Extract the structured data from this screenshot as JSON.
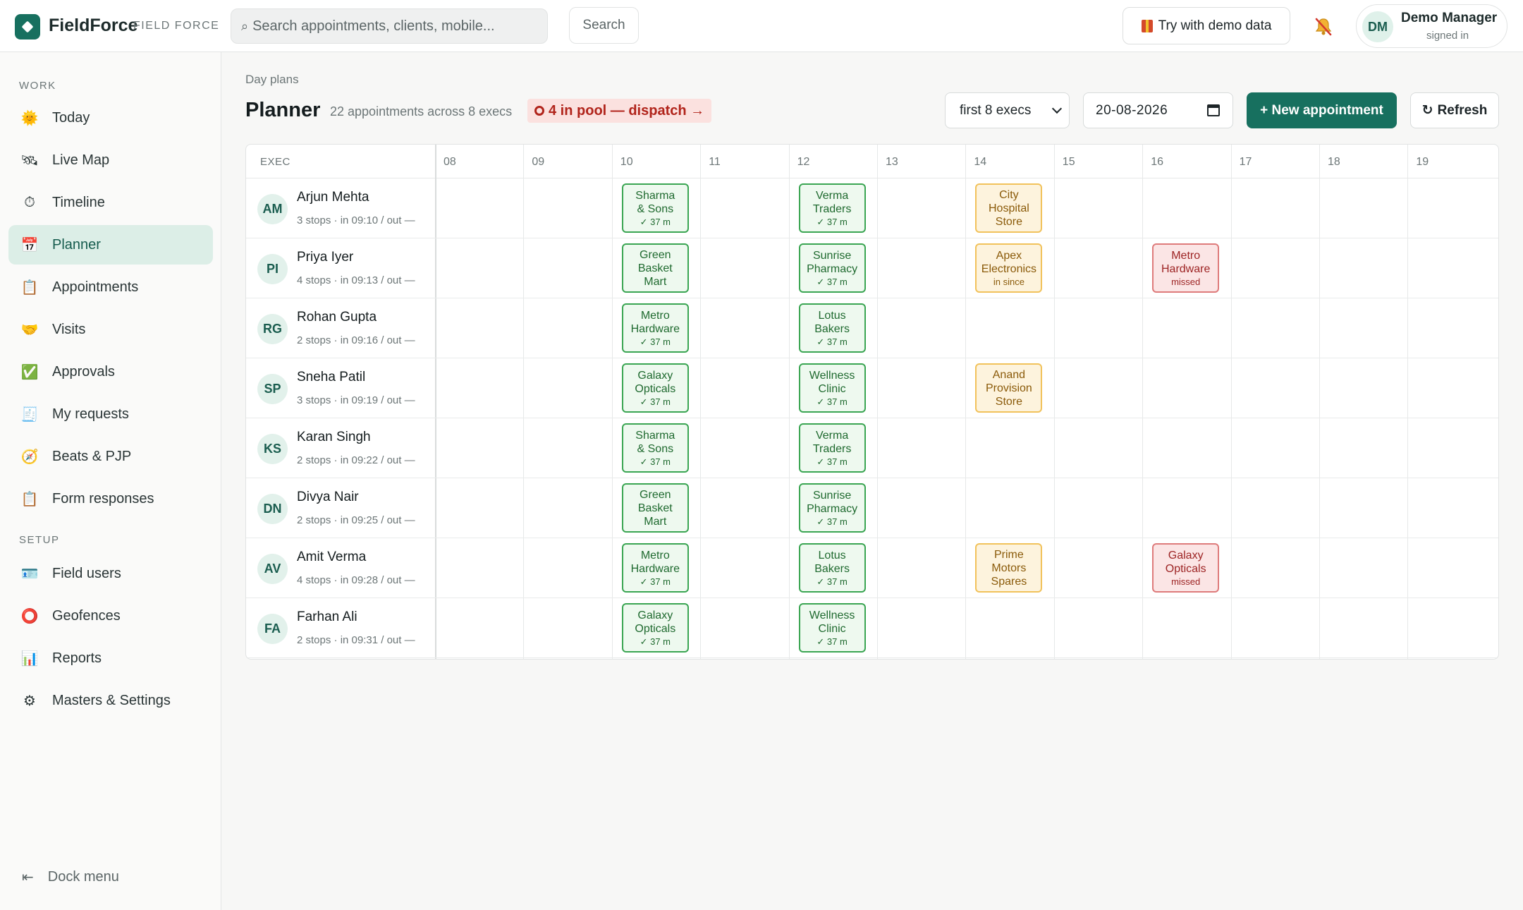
{
  "app": {
    "brand": "FieldForce",
    "brand_sub": "FIELD FORCE"
  },
  "search": {
    "placeholder": "Search appointments, clients, mobile...",
    "button": "Search"
  },
  "topbar": {
    "demo_button": "Try with demo data"
  },
  "user": {
    "initials": "DM",
    "name": "Demo Manager",
    "status": "signed in"
  },
  "sidebar": {
    "work_label": "WORK",
    "setup_label": "SETUP",
    "work_items": [
      {
        "label": "Today",
        "icon": "sun-icon",
        "glyph": "🌞"
      },
      {
        "label": "Live Map",
        "icon": "satellite-icon",
        "glyph": "🛰"
      },
      {
        "label": "Timeline",
        "icon": "stopwatch-icon",
        "glyph": "⏱"
      },
      {
        "label": "Planner",
        "icon": "calendar-icon",
        "glyph": "📅"
      },
      {
        "label": "Appointments",
        "icon": "clipboard-icon",
        "glyph": "📋"
      },
      {
        "label": "Visits",
        "icon": "handshake-icon",
        "glyph": "🤝"
      },
      {
        "label": "Approvals",
        "icon": "check-icon",
        "glyph": "✅"
      },
      {
        "label": "My requests",
        "icon": "receipt-icon",
        "glyph": "🧾"
      },
      {
        "label": "Beats & PJP",
        "icon": "compass-icon",
        "glyph": "🧭"
      },
      {
        "label": "Form responses",
        "icon": "clipboard-icon",
        "glyph": "📋"
      }
    ],
    "setup_items": [
      {
        "label": "Field users",
        "icon": "id-card-icon",
        "glyph": "🪪"
      },
      {
        "label": "Geofences",
        "icon": "ring-icon",
        "glyph": "⭕"
      },
      {
        "label": "Reports",
        "icon": "bar-chart-icon",
        "glyph": "📊"
      },
      {
        "label": "Masters & Settings",
        "icon": "gear-icon",
        "glyph": "⚙"
      }
    ],
    "active": "Planner",
    "dock_label": "Dock menu"
  },
  "page": {
    "breadcrumb": "Day plans",
    "title": "Planner",
    "subtitle": "22 appointments across 8 execs",
    "pool_badge": "4 in pool — dispatch →",
    "exec_select": "first 8 execs",
    "date": "20-08-2026",
    "new_button": "+ New appointment",
    "refresh_button": "Refresh"
  },
  "planner": {
    "exec_header": "EXEC",
    "hours": [
      "08",
      "09",
      "10",
      "11",
      "12",
      "13",
      "14",
      "15",
      "16",
      "17",
      "18",
      "19"
    ],
    "rows": [
      {
        "initials": "AM",
        "name": "Arjun Mehta",
        "meta": "3 stops · in 09:10 / out —",
        "appts": [
          {
            "hour": "10",
            "lines": [
              "Sharma",
              "& Sons"
            ],
            "sub": "✓ 37 m",
            "status": "done"
          },
          {
            "hour": "12",
            "lines": [
              "Verma",
              "Traders"
            ],
            "sub": "✓ 37 m",
            "status": "done"
          },
          {
            "hour": "14",
            "lines": [
              "City",
              "Hospital",
              "Store"
            ],
            "sub": "",
            "status": "pending"
          }
        ]
      },
      {
        "initials": "PI",
        "name": "Priya Iyer",
        "meta": "4 stops · in 09:13 / out —",
        "appts": [
          {
            "hour": "10",
            "lines": [
              "Green",
              "Basket",
              "Mart"
            ],
            "sub": "",
            "status": "done"
          },
          {
            "hour": "12",
            "lines": [
              "Sunrise",
              "Pharmacy"
            ],
            "sub": "✓ 37 m",
            "status": "done"
          },
          {
            "hour": "14",
            "lines": [
              "Apex",
              "Electronics"
            ],
            "sub": "in since",
            "status": "pending"
          },
          {
            "hour": "16",
            "lines": [
              "Metro",
              "Hardware"
            ],
            "sub": "missed",
            "status": "missed"
          }
        ]
      },
      {
        "initials": "RG",
        "name": "Rohan Gupta",
        "meta": "2 stops · in 09:16 / out —",
        "appts": [
          {
            "hour": "10",
            "lines": [
              "Metro",
              "Hardware"
            ],
            "sub": "✓ 37 m",
            "status": "done"
          },
          {
            "hour": "12",
            "lines": [
              "Lotus",
              "Bakers"
            ],
            "sub": "✓ 37 m",
            "status": "done"
          }
        ]
      },
      {
        "initials": "SP",
        "name": "Sneha Patil",
        "meta": "3 stops · in 09:19 / out —",
        "appts": [
          {
            "hour": "10",
            "lines": [
              "Galaxy",
              "Opticals"
            ],
            "sub": "✓ 37 m",
            "status": "done"
          },
          {
            "hour": "12",
            "lines": [
              "Wellness",
              "Clinic"
            ],
            "sub": "✓ 37 m",
            "status": "done"
          },
          {
            "hour": "14",
            "lines": [
              "Anand",
              "Provision",
              "Store"
            ],
            "sub": "",
            "status": "pending"
          }
        ]
      },
      {
        "initials": "KS",
        "name": "Karan Singh",
        "meta": "2 stops · in 09:22 / out —",
        "appts": [
          {
            "hour": "10",
            "lines": [
              "Sharma",
              "& Sons"
            ],
            "sub": "✓ 37 m",
            "status": "done"
          },
          {
            "hour": "12",
            "lines": [
              "Verma",
              "Traders"
            ],
            "sub": "✓ 37 m",
            "status": "done"
          }
        ]
      },
      {
        "initials": "DN",
        "name": "Divya Nair",
        "meta": "2 stops · in 09:25 / out —",
        "appts": [
          {
            "hour": "10",
            "lines": [
              "Green",
              "Basket",
              "Mart"
            ],
            "sub": "",
            "status": "done"
          },
          {
            "hour": "12",
            "lines": [
              "Sunrise",
              "Pharmacy"
            ],
            "sub": "✓ 37 m",
            "status": "done"
          }
        ]
      },
      {
        "initials": "AV",
        "name": "Amit Verma",
        "meta": "4 stops · in 09:28 / out —",
        "appts": [
          {
            "hour": "10",
            "lines": [
              "Metro",
              "Hardware"
            ],
            "sub": "✓ 37 m",
            "status": "done"
          },
          {
            "hour": "12",
            "lines": [
              "Lotus",
              "Bakers"
            ],
            "sub": "✓ 37 m",
            "status": "done"
          },
          {
            "hour": "14",
            "lines": [
              "Prime",
              "Motors",
              "Spares"
            ],
            "sub": "",
            "status": "pending"
          },
          {
            "hour": "16",
            "lines": [
              "Galaxy",
              "Opticals"
            ],
            "sub": "missed",
            "status": "missed"
          }
        ]
      },
      {
        "initials": "FA",
        "name": "Farhan Ali",
        "meta": "2 stops · in 09:31 / out —",
        "appts": [
          {
            "hour": "10",
            "lines": [
              "Galaxy",
              "Opticals"
            ],
            "sub": "✓ 37 m",
            "status": "done"
          },
          {
            "hour": "12",
            "lines": [
              "Wellness",
              "Clinic"
            ],
            "sub": "✓ 37 m",
            "status": "done"
          }
        ]
      }
    ]
  }
}
